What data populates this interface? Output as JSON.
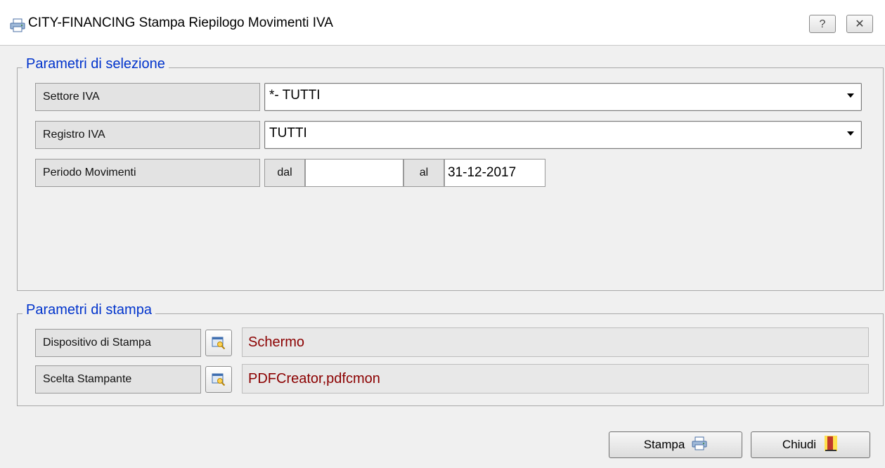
{
  "window": {
    "title": "CITY-FINANCING  Stampa Riepilogo Movimenti IVA",
    "help_glyph": "?",
    "close_glyph": "✕"
  },
  "selection": {
    "group_title": "Parametri di selezione",
    "settore": {
      "label": "Settore IVA",
      "value": "*- TUTTI"
    },
    "registro": {
      "label": "Registro IVA",
      "value": "TUTTI"
    },
    "periodo": {
      "label": "Periodo Movimenti",
      "from_label": "dal",
      "from_value": "",
      "to_label": "al",
      "to_value": "31-12-2017"
    }
  },
  "print": {
    "group_title": "Parametri di stampa",
    "dispositivo": {
      "label": "Dispositivo di Stampa",
      "value": "Schermo"
    },
    "stampante": {
      "label": "Scelta Stampante",
      "value": "PDFCreator,pdfcmon"
    }
  },
  "buttons": {
    "stampa": "Stampa",
    "chiudi": "Chiudi"
  },
  "icons": {
    "app": "printer-icon",
    "picker": "browse-icon",
    "stampa": "printer-icon",
    "chiudi": "door-exit-icon"
  },
  "colors": {
    "group_title": "#0033cc",
    "value_text": "#8b0000",
    "background": "#f0f0f0"
  }
}
